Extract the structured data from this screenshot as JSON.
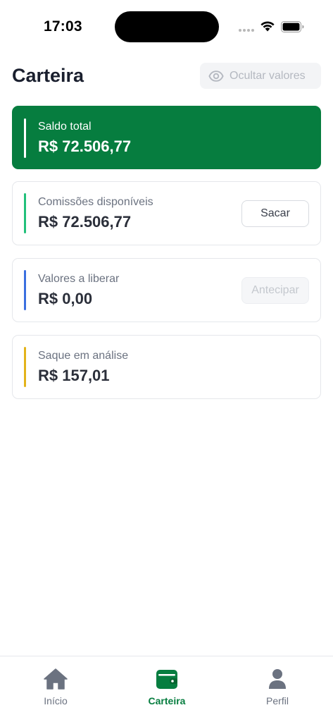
{
  "status_bar": {
    "time": "17:03"
  },
  "header": {
    "title": "Carteira",
    "hide_values_label": "Ocultar valores",
    "hide_values_icon": "eye-icon"
  },
  "cards": {
    "total": {
      "label": "Saldo total",
      "value": "R$ 72.506,77",
      "color": "#067d3f"
    },
    "commissions": {
      "label": "Comissões disponíveis",
      "value": "R$ 72.506,77",
      "button": "Sacar",
      "accent": "#22c07a"
    },
    "release": {
      "label": "Valores a liberar",
      "value": "R$ 0,00",
      "button": "Antecipar",
      "accent": "#3b6fe0"
    },
    "analysis": {
      "label": "Saque em análise",
      "value": "R$ 157,01",
      "accent": "#e3b31a"
    }
  },
  "bottom_nav": {
    "items": [
      {
        "label": "Início",
        "icon": "home-icon",
        "active": false
      },
      {
        "label": "Carteira",
        "icon": "wallet-icon",
        "active": true
      },
      {
        "label": "Perfil",
        "icon": "user-icon",
        "active": false
      }
    ],
    "active_color": "#067d3f",
    "inactive_color": "#6b7280"
  }
}
